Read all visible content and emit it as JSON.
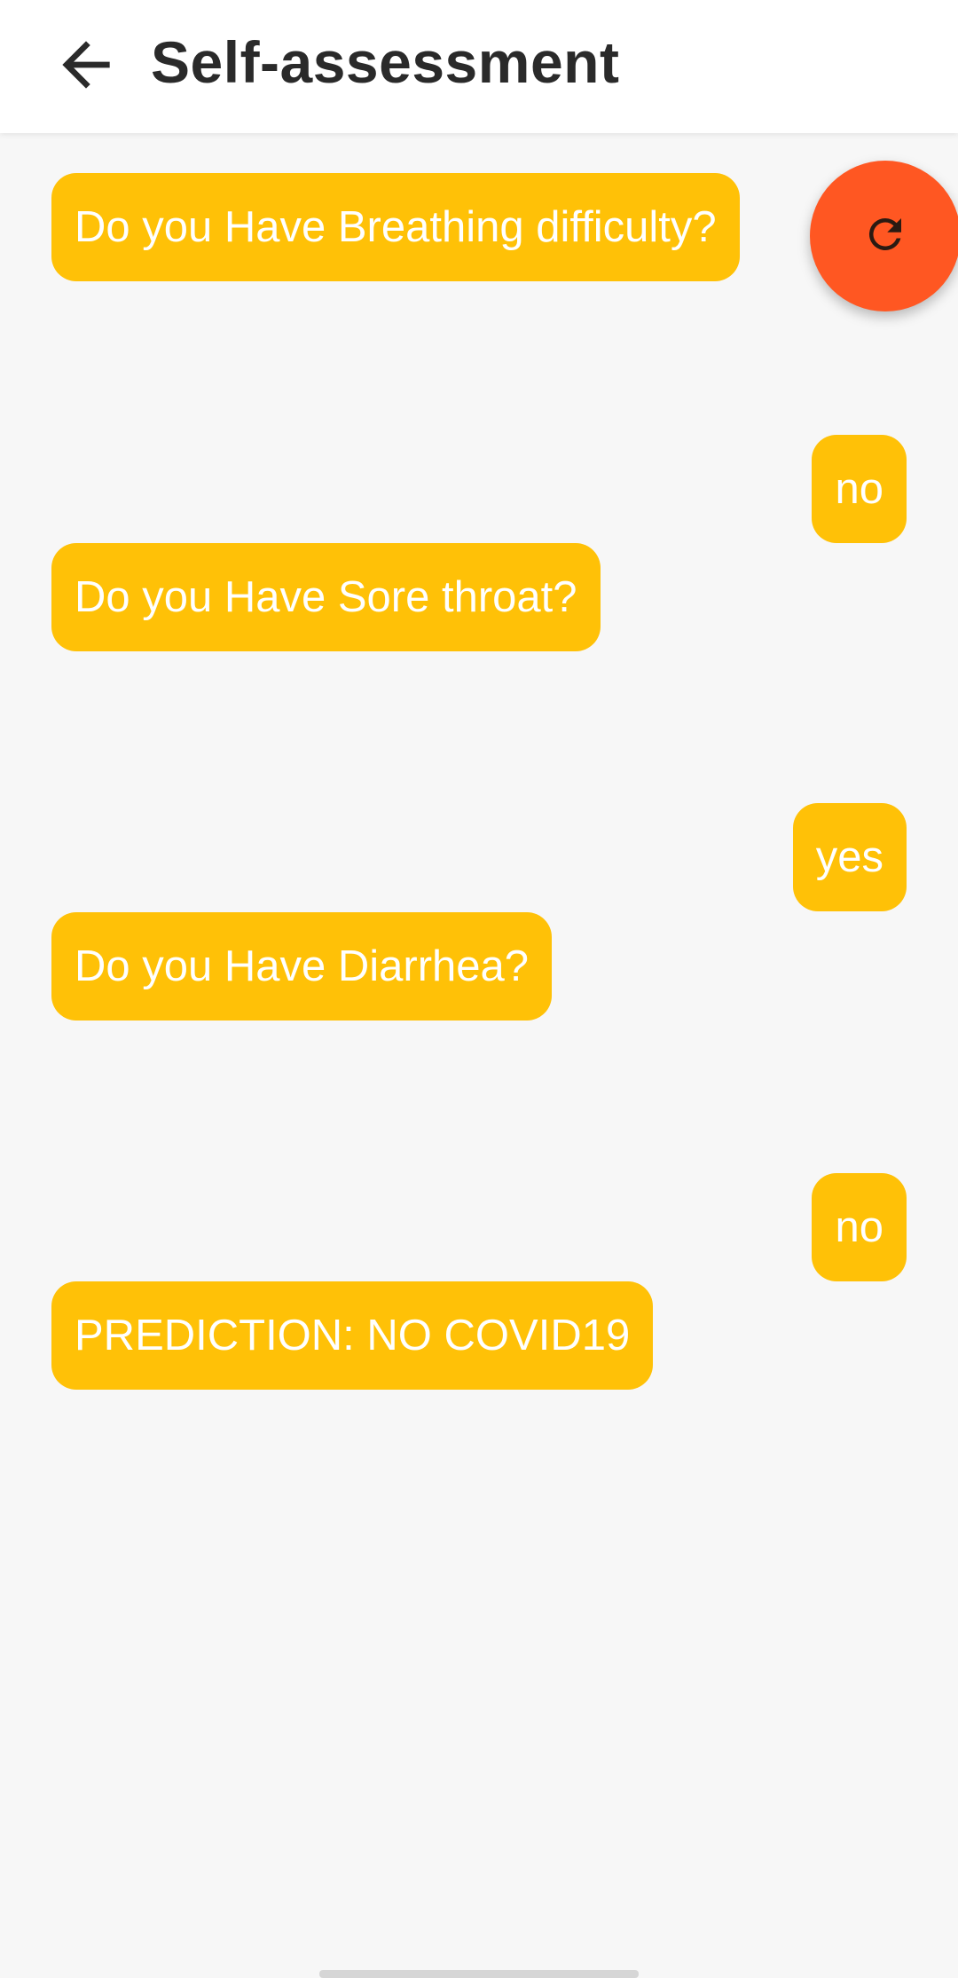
{
  "header": {
    "title": "Self-assessment",
    "back_icon": "arrow-left-icon"
  },
  "chat": {
    "messages": [
      {
        "sender": "bot",
        "text": "Do you Have Breathing difficulty?"
      },
      {
        "sender": "user",
        "text": "no"
      },
      {
        "sender": "bot",
        "text": "Do you Have Sore throat?"
      },
      {
        "sender": "user",
        "text": "yes"
      },
      {
        "sender": "bot",
        "text": "Do you Have Diarrhea?"
      },
      {
        "sender": "user",
        "text": "no"
      },
      {
        "sender": "bot",
        "text": "PREDICTION: NO COVID19"
      }
    ]
  },
  "fab": {
    "icon": "refresh-icon",
    "color": "#ff5722"
  },
  "colors": {
    "bubble": "#ffc107",
    "bubble_text": "#ffffff",
    "background": "#f7f7f7",
    "header_bg": "#ffffff"
  }
}
